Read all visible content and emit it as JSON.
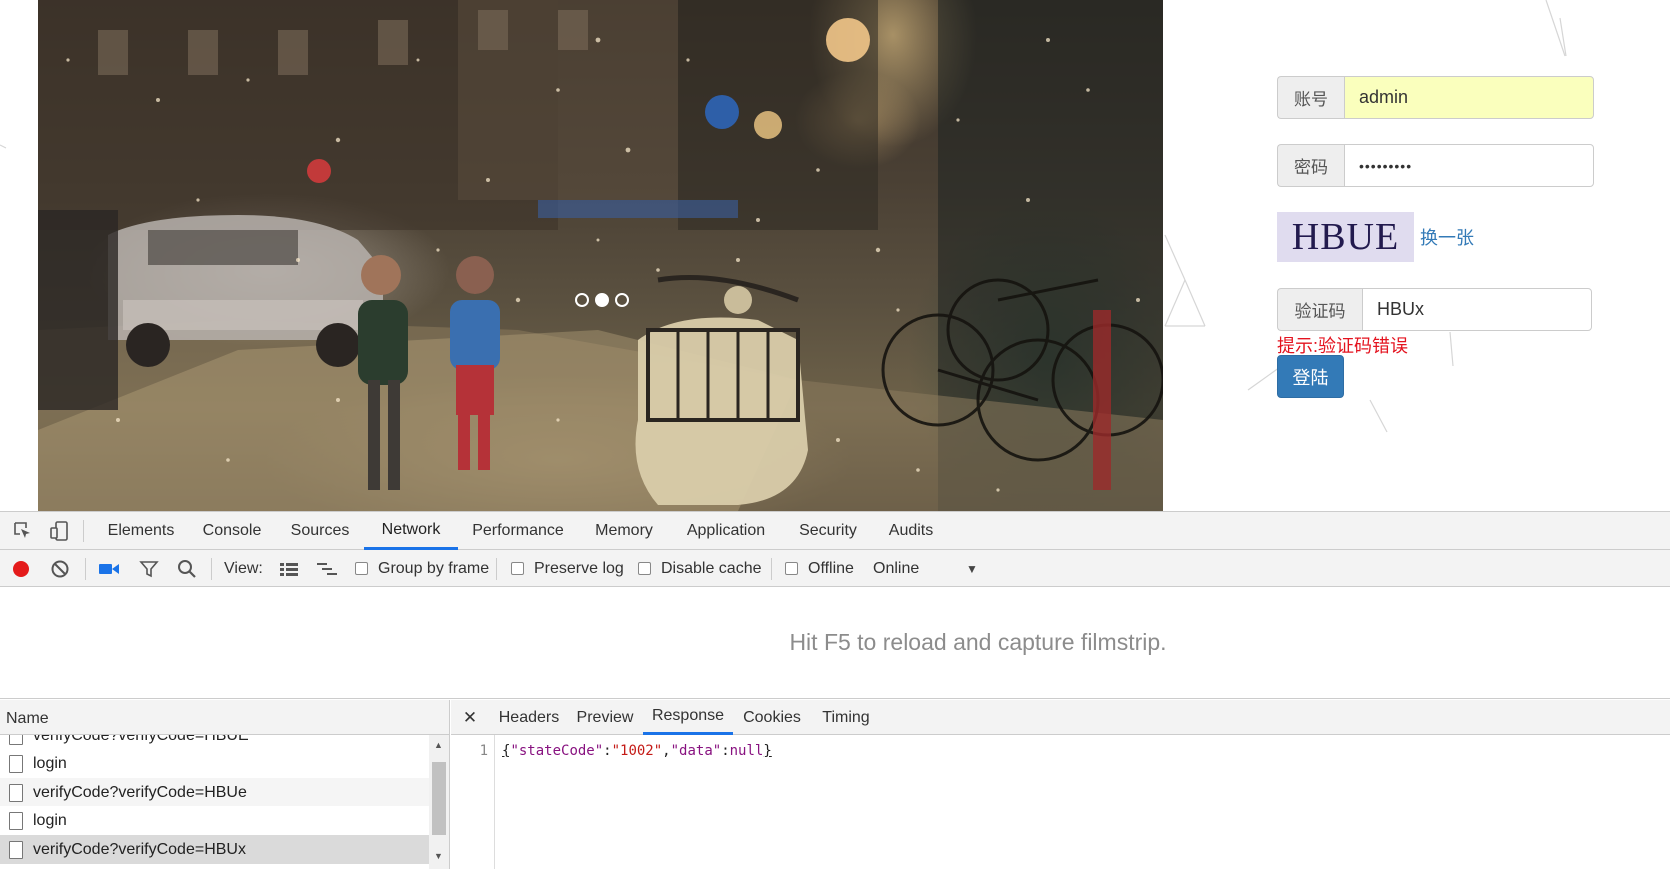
{
  "login": {
    "account_label": "账号",
    "account_value": "admin",
    "password_label": "密码",
    "password_value": "•••••••••",
    "captcha_text": "HBUE",
    "captcha_refresh": "换一张",
    "verify_label": "验证码",
    "verify_value": "HBUx",
    "error_hint": "提示:验证码错误",
    "login_button": "登陆"
  },
  "devtools": {
    "tabs": [
      "Elements",
      "Console",
      "Sources",
      "Network",
      "Performance",
      "Memory",
      "Application",
      "Security",
      "Audits"
    ],
    "active_tab": "Network",
    "toolbar": {
      "view_label": "View:",
      "group_by_frame": "Group by frame",
      "preserve_log": "Preserve log",
      "disable_cache": "Disable cache",
      "offline": "Offline",
      "throttle": "Online"
    },
    "filmstrip_hint": "Hit F5 to reload and capture filmstrip.",
    "name_header": "Name",
    "requests": [
      "verifyCode?verifyCode=HBUE",
      "login",
      "verifyCode?verifyCode=HBUe",
      "login",
      "verifyCode?verifyCode=HBUx"
    ],
    "detail_tabs": [
      "Headers",
      "Preview",
      "Response",
      "Cookies",
      "Timing"
    ],
    "active_detail_tab": "Response",
    "response": {
      "line_number": "1",
      "brace_open": "{",
      "key1": "\"stateCode\"",
      "colon1": ":",
      "val1": "\"1002\"",
      "comma": ",",
      "key2": "\"data\"",
      "colon2": ":",
      "val2": "null",
      "brace_close": "}"
    }
  },
  "colors": {
    "primary_button": "#337ab7",
    "error_text": "#e4131f",
    "active_tab_underline": "#1a73e8",
    "autofill_bg": "#faffbd"
  }
}
